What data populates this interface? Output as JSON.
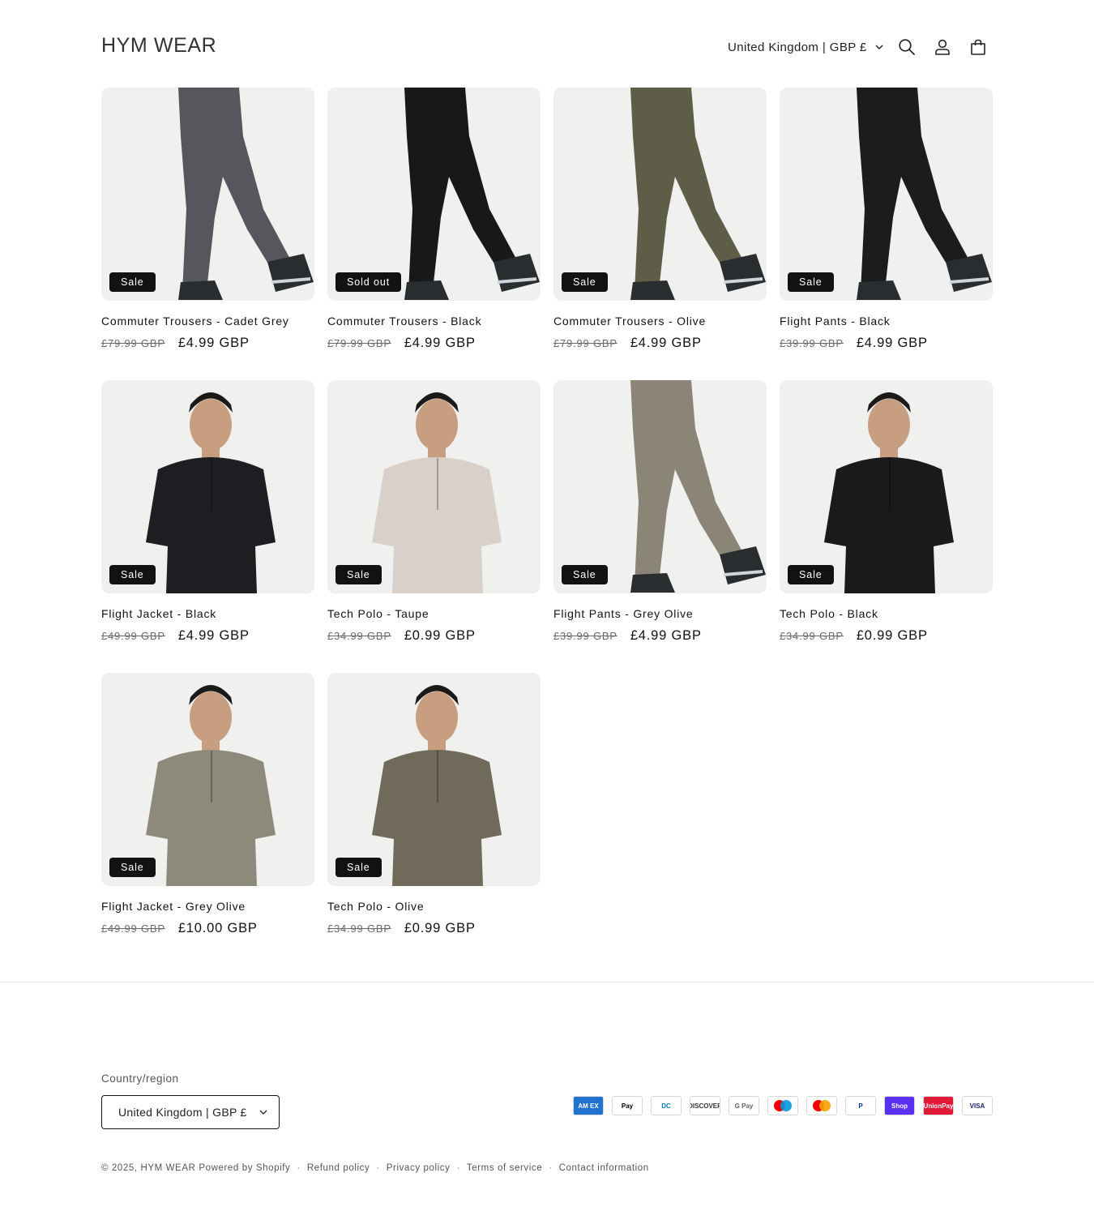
{
  "header": {
    "logo": "HYM WEAR",
    "country_selector": "United Kingdom | GBP £",
    "icons": [
      "search-icon",
      "account-icon",
      "cart-icon"
    ]
  },
  "products": [
    {
      "title": "Commuter Trousers - Cadet Grey",
      "regular_price": "£79.99 GBP",
      "sale_price": "£4.99 GBP",
      "badge": "Sale"
    },
    {
      "title": "Commuter Trousers - Black",
      "regular_price": "£79.99 GBP",
      "sale_price": "£4.99 GBP",
      "badge": "Sold out"
    },
    {
      "title": "Commuter Trousers - Olive",
      "regular_price": "£79.99 GBP",
      "sale_price": "£4.99 GBP",
      "badge": "Sale"
    },
    {
      "title": "Flight Pants - Black",
      "regular_price": "£39.99 GBP",
      "sale_price": "£4.99 GBP",
      "badge": "Sale"
    },
    {
      "title": "Flight Jacket - Black",
      "regular_price": "£49.99 GBP",
      "sale_price": "£4.99 GBP",
      "badge": "Sale"
    },
    {
      "title": "Tech Polo - Taupe",
      "regular_price": "£34.99 GBP",
      "sale_price": "£0.99 GBP",
      "badge": "Sale"
    },
    {
      "title": "Flight Pants - Grey Olive",
      "regular_price": "£39.99 GBP",
      "sale_price": "£4.99 GBP",
      "badge": "Sale"
    },
    {
      "title": "Tech Polo - Black",
      "regular_price": "£34.99 GBP",
      "sale_price": "£0.99 GBP",
      "badge": "Sale"
    },
    {
      "title": "Flight Jacket - Grey Olive",
      "regular_price": "£49.99 GBP",
      "sale_price": "£10.00 GBP",
      "badge": "Sale"
    },
    {
      "title": "Tech Polo - Olive",
      "regular_price": "£34.99 GBP",
      "sale_price": "£0.99 GBP",
      "badge": "Sale"
    }
  ],
  "product_colors": [
    "#55575c",
    "#17181a",
    "#5e5d48",
    "#1b1c1e",
    "#1d1e21",
    "#d9d1c9",
    "#8a8577",
    "#1a1a1a",
    "#8d8a7c",
    "#6f6a5a"
  ],
  "footer": {
    "country_label": "Country/region",
    "country_selector": "United Kingdom | GBP £",
    "payment_methods": [
      "American Express",
      "Apple Pay",
      "Diners Club",
      "Discover",
      "Google Pay",
      "Maestro",
      "Mastercard",
      "PayPal",
      "Shop Pay",
      "Union Pay",
      "Visa"
    ],
    "payment_labels": [
      "AM EX",
      "Pay",
      "DC",
      "DISCOVER",
      "G Pay",
      "",
      "",
      "P",
      "Shop",
      "UnionPay",
      "VISA"
    ],
    "copyright_prefix": "© 2025, ",
    "brand_link": "HYM WEAR",
    "powered_by": "Powered by Shopify",
    "links": [
      "Refund policy",
      "Privacy policy",
      "Terms of service",
      "Contact information"
    ]
  }
}
